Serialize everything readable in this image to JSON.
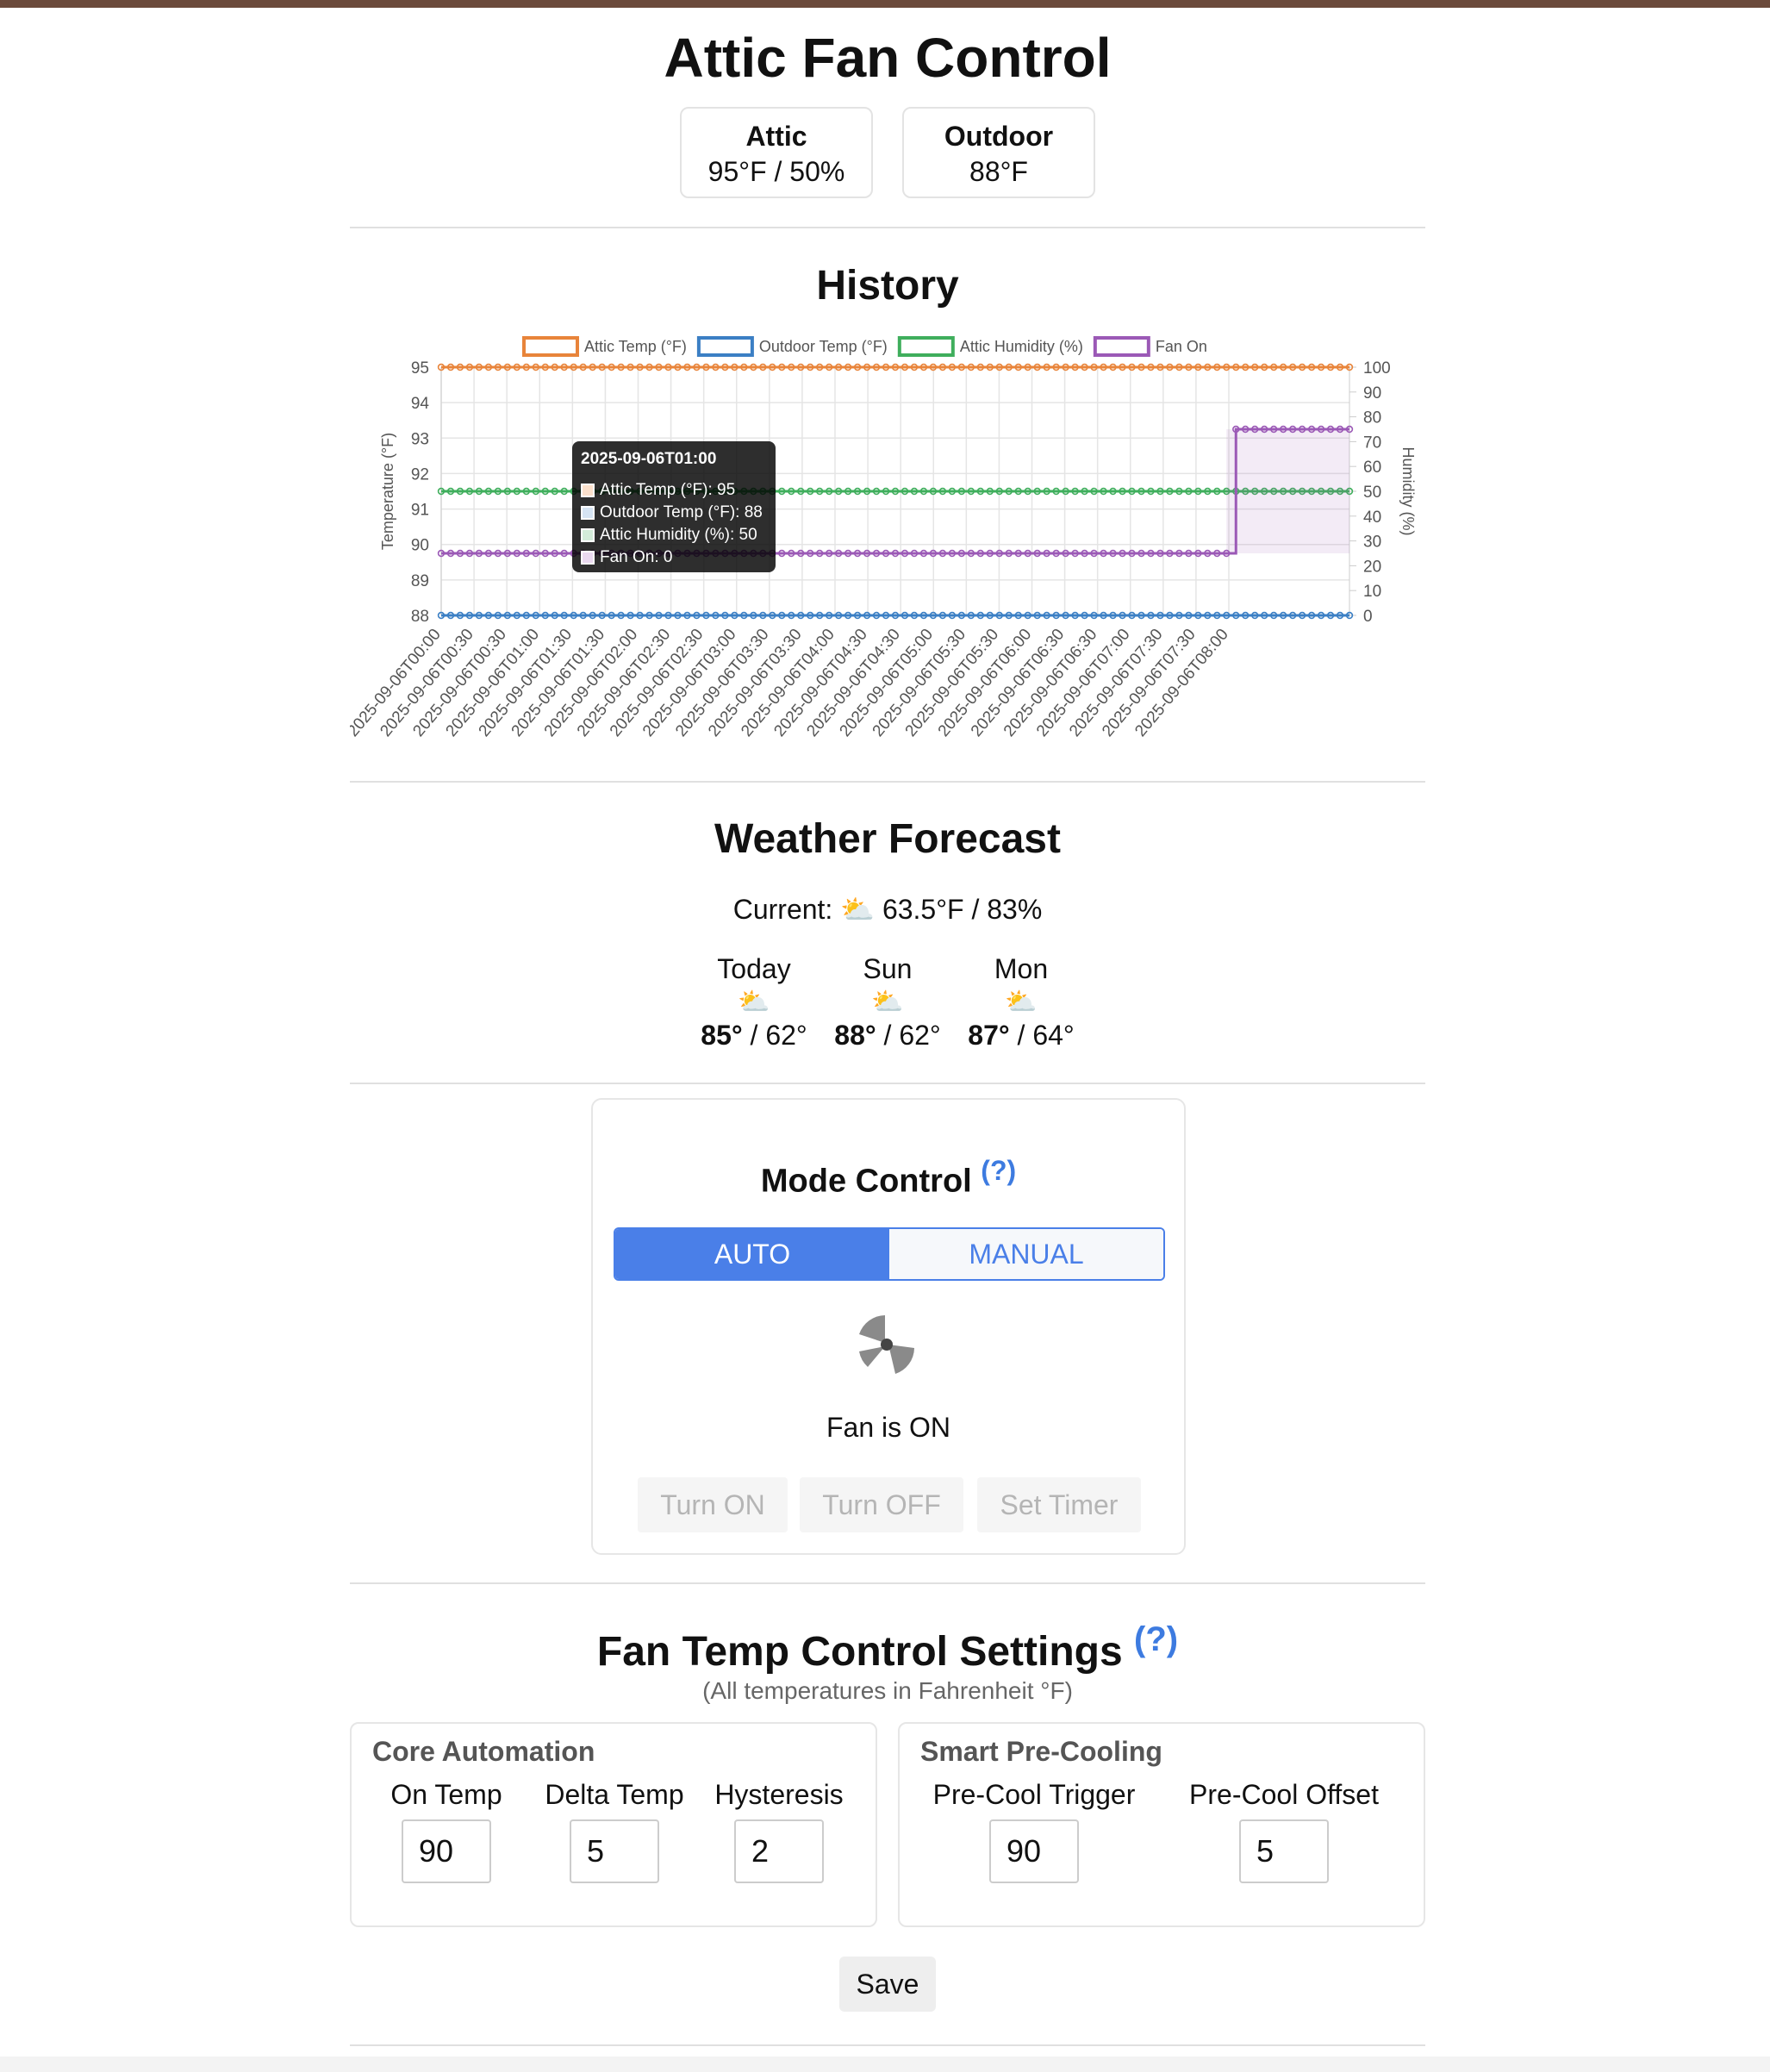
{
  "app": {
    "title": "Attic Fan Control"
  },
  "stats": [
    {
      "label": "Attic",
      "value": "95°F / 50%"
    },
    {
      "label": "Outdoor",
      "value": "88°F"
    }
  ],
  "history": {
    "title": "History",
    "tooltip": {
      "title": "2025-09-06T01:00",
      "rows": [
        {
          "text": "Attic Temp (°F): 95",
          "color": "#e8843a"
        },
        {
          "text": "Outdoor Temp (°F): 88",
          "color": "#3b7fc4"
        },
        {
          "text": "Attic Humidity (%): 50",
          "color": "#3fae5c"
        },
        {
          "text": "Fan On: 0",
          "color": "#9b59b6"
        }
      ]
    }
  },
  "chart_data": {
    "type": "line",
    "x_tick_labels": [
      "2025-09-06T00:00",
      "2025-09-06T00:30",
      "2025-09-06T00:30",
      "2025-09-06T01:00",
      "2025-09-06T01:30",
      "2025-09-06T01:30",
      "2025-09-06T02:00",
      "2025-09-06T02:30",
      "2025-09-06T02:30",
      "2025-09-06T03:00",
      "2025-09-06T03:30",
      "2025-09-06T03:30",
      "2025-09-06T04:00",
      "2025-09-06T04:30",
      "2025-09-06T04:30",
      "2025-09-06T05:00",
      "2025-09-06T05:30",
      "2025-09-06T05:30",
      "2025-09-06T06:00",
      "2025-09-06T06:30",
      "2025-09-06T06:30",
      "2025-09-06T07:00",
      "2025-09-06T07:30",
      "2025-09-06T07:30",
      "2025-09-06T08:00"
    ],
    "series": [
      {
        "name": "Attic Temp (°F)",
        "color": "#e8843a",
        "axis": "left",
        "values_description": "constant",
        "value": 95
      },
      {
        "name": "Outdoor Temp (°F)",
        "color": "#3b7fc4",
        "axis": "left",
        "value": 88
      },
      {
        "name": "Attic Humidity (%)",
        "color": "#3fae5c",
        "axis": "right",
        "value": 50
      },
      {
        "name": "Fan On",
        "color": "#9b59b6",
        "axis": "right",
        "step": true,
        "values_before": 25,
        "values_after": 75,
        "switch_x": "2025-09-06T07:00"
      }
    ],
    "ylabel": "Temperature (°F)",
    "y2label": "Humidity (%)",
    "ylim": [
      88,
      95
    ],
    "y_ticks": [
      88,
      89,
      90,
      91,
      92,
      93,
      94,
      95
    ],
    "y2lim": [
      0,
      100
    ],
    "y2_ticks": [
      0,
      10,
      20,
      30,
      40,
      50,
      60,
      70,
      80,
      90,
      100
    ],
    "grid": true,
    "legend_position": "top"
  },
  "forecast": {
    "title": "Weather Forecast",
    "current_label": "Current:",
    "current_icon": "⛅",
    "current_value": "63.5°F / 83%",
    "days": [
      {
        "name": "Today",
        "icon": "⛅",
        "high": "85°",
        "low": "62°"
      },
      {
        "name": "Sun",
        "icon": "⛅",
        "high": "88°",
        "low": "62°"
      },
      {
        "name": "Mon",
        "icon": "⛅",
        "high": "87°",
        "low": "64°"
      }
    ]
  },
  "mode": {
    "title": "Mode Control",
    "help": "(?)",
    "auto_label": "AUTO",
    "manual_label": "MANUAL",
    "fan_status": "Fan is ON",
    "turn_on": "Turn ON",
    "turn_off": "Turn OFF",
    "set_timer": "Set Timer"
  },
  "settings": {
    "title": "Fan Temp Control Settings",
    "help": "(?)",
    "subtitle": "(All temperatures in Fahrenheit °F)",
    "core": {
      "legend": "Core Automation",
      "fields": [
        {
          "label": "On Temp",
          "value": "90"
        },
        {
          "label": "Delta Temp",
          "value": "5"
        },
        {
          "label": "Hysteresis",
          "value": "2"
        }
      ]
    },
    "precool": {
      "legend": "Smart Pre-Cooling",
      "fields": [
        {
          "label": "Pre-Cool Trigger",
          "value": "90"
        },
        {
          "label": "Pre-Cool Offset",
          "value": "5"
        }
      ]
    },
    "save_label": "Save"
  }
}
